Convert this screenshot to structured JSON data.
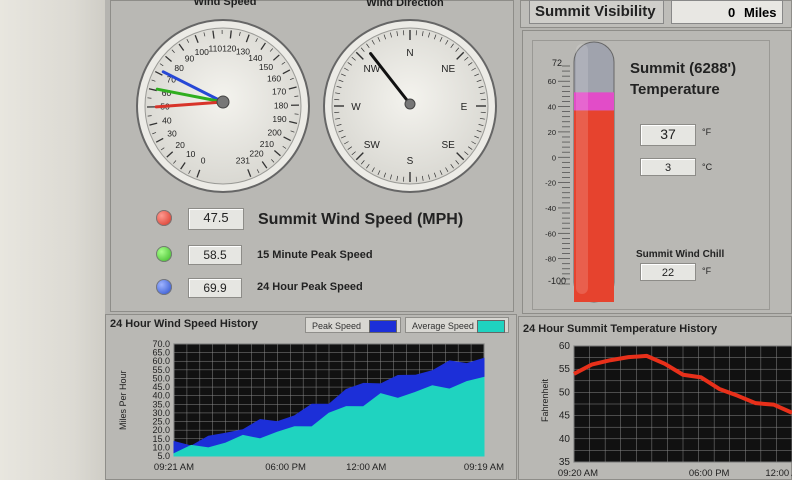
{
  "header": {
    "visibility_label": "Summit Visibility",
    "visibility_value": "0",
    "visibility_unit": "Miles"
  },
  "gauges": {
    "wind_speed_title": "Wind Speed",
    "wind_direction_title": "Wind Direction",
    "speed_ticks": [
      "0",
      "10",
      "20",
      "30",
      "40",
      "50",
      "60",
      "70",
      "80",
      "90",
      "100",
      "110",
      "120",
      "130",
      "140",
      "150",
      "160",
      "170",
      "180",
      "190",
      "200",
      "210",
      "220",
      "231"
    ],
    "direction_ticks": [
      "N",
      "NE",
      "E",
      "SE",
      "S",
      "SW",
      "W",
      "NW"
    ],
    "needles": {
      "current": 47.5,
      "peak_15min": 58.5,
      "peak_24hr": 69.9
    },
    "direction_degrees": 322
  },
  "readouts": {
    "current_value": "47.5",
    "current_label": "Summit Wind Speed (MPH)",
    "peak15_value": "58.5",
    "peak15_label": "15 Minute Peak Speed",
    "peak24_value": "69.9",
    "peak24_label": "24 Hour Peak Speed"
  },
  "temperature": {
    "title_line1": "Summit (6288')",
    "title_line2": "Temperature",
    "value_f": "37",
    "unit_f": "°F",
    "value_c": "3",
    "unit_c": "°C",
    "windchill_label": "Summit Wind Chill",
    "windchill_value": "22",
    "windchill_unit": "°F",
    "scale_ticks": [
      "72",
      "",
      "",
      "",
      "",
      "",
      "",
      "",
      "",
      "",
      "",
      "",
      "",
      "",
      "",
      "",
      "",
      "",
      "",
      "",
      "",
      "",
      "",
      "-100"
    ],
    "scale_min": -100,
    "scale_max": 72,
    "level": 37
  },
  "wind_history": {
    "title": "24 Hour Wind Speed History",
    "legend_peak": "Peak Speed",
    "legend_avg": "Average Speed",
    "ylabel": "Miles Per Hour",
    "y_ticks": [
      "70.0",
      "65.0",
      "60.0",
      "55.0",
      "50.0",
      "45.0",
      "40.0",
      "35.0",
      "30.0",
      "25.0",
      "20.0",
      "15.0",
      "10.0",
      "5.0"
    ],
    "x_ticks": [
      "09:21 AM",
      "06:00 PM",
      "12:00 AM",
      "09:19 AM"
    ],
    "colors": {
      "peak": "#1c2fd8",
      "average": "#1fd3c0"
    }
  },
  "temp_history": {
    "title": "24 Hour Summit Temperature History",
    "ylabel": "Fahrenheit",
    "y_ticks": [
      "60",
      "55",
      "50",
      "45",
      "40",
      "35"
    ],
    "x_ticks": [
      "09:20 AM",
      "06:00 PM",
      "12:00 AM"
    ],
    "color": "#e8301a"
  },
  "chart_data": [
    {
      "type": "area",
      "title": "24 Hour Wind Speed History",
      "ylabel": "Miles Per Hour",
      "ylim": [
        5,
        70
      ],
      "x": [
        "09:21 AM",
        "",
        "",
        "",
        "",
        "",
        "06:00 PM",
        "",
        "",
        "",
        "",
        "",
        "12:00 AM",
        "",
        "",
        "",
        "",
        "",
        "09:19 AM"
      ],
      "series": [
        {
          "name": "Peak Speed",
          "values": [
            12,
            13,
            15,
            18,
            22,
            24,
            26,
            29,
            33,
            37,
            43,
            46,
            49,
            50,
            52,
            56,
            58,
            60,
            62
          ]
        },
        {
          "name": "Average Speed",
          "values": [
            8,
            9,
            11,
            13,
            15,
            17,
            18,
            21,
            24,
            28,
            34,
            35,
            39,
            40,
            42,
            44,
            46,
            47,
            50
          ]
        }
      ]
    },
    {
      "type": "line",
      "title": "24 Hour Summit Temperature History",
      "ylabel": "Fahrenheit",
      "ylim": [
        35,
        60
      ],
      "x": [
        "09:20 AM",
        "",
        "",
        "",
        "",
        "06:00 PM",
        "",
        "",
        "",
        "",
        "12:00 AM",
        "",
        ""
      ],
      "series": [
        {
          "values": [
            54,
            56,
            57,
            57.5,
            58,
            56,
            54,
            53,
            51,
            49,
            48,
            47,
            46
          ]
        }
      ]
    }
  ]
}
